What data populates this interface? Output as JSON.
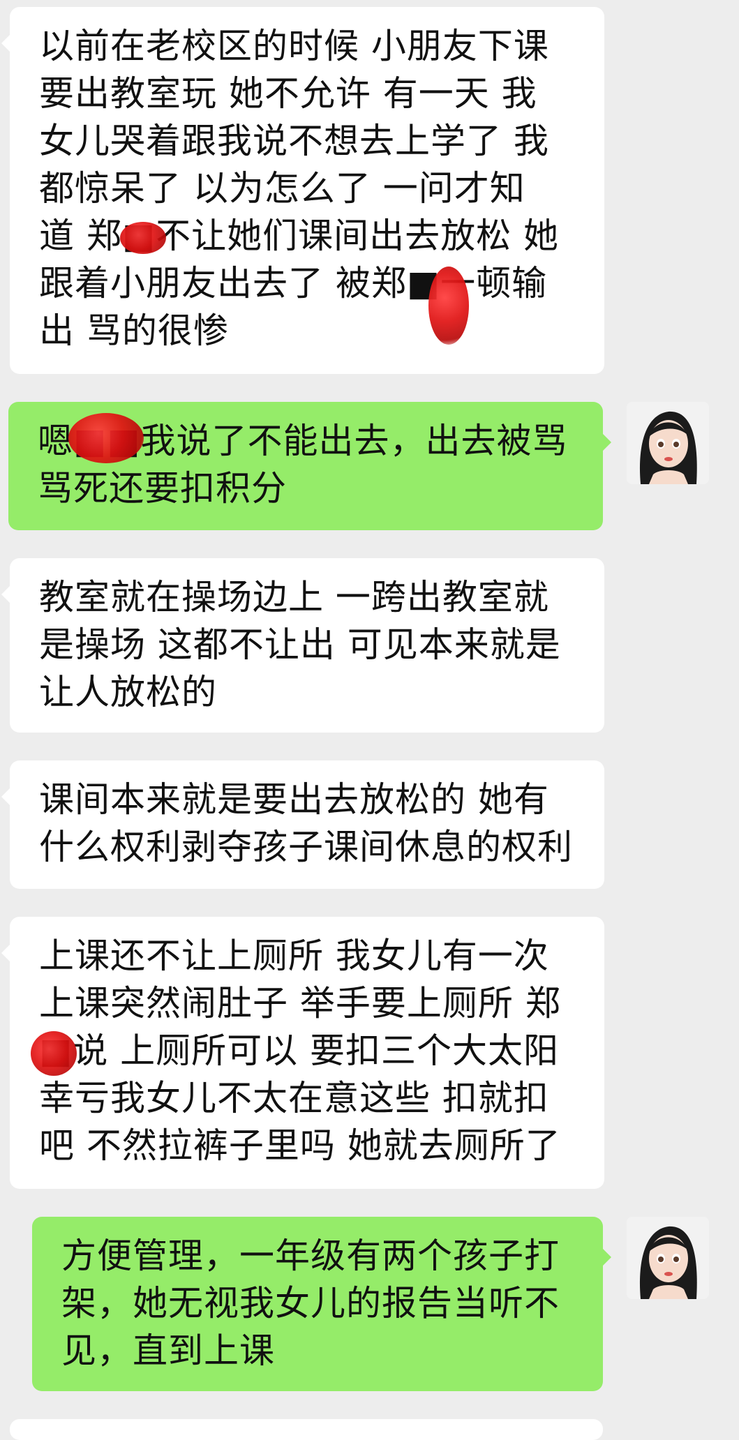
{
  "chat": {
    "messages": [
      {
        "direction": "incoming",
        "text": "以前在老校区的时候 小朋友下课\n要出教室玩 她不允许 有一天 我\n女儿哭着跟我说不想去上学了 我\n都惊呆了 以为怎么了 一问才知\n道 郑■不让她们课间出去放松 她\n跟着小朋友出去了 被郑■一顿输\n出 骂的很惨"
      },
      {
        "direction": "outgoing",
        "text": "嗯■■我说了不能出去，出去被骂\n骂死还要扣积分"
      },
      {
        "direction": "incoming",
        "text": "教室就在操场边上 一跨出教室就\n是操场 这都不让出 可见本来就是\n让人放松的"
      },
      {
        "direction": "incoming",
        "text": "课间本来就是要出去放松的 她有\n什么权利剥夺孩子课间休息的权利"
      },
      {
        "direction": "incoming",
        "text": "上课还不让上厕所 我女儿有一次\n上课突然闹肚子 举手要上厕所 郑\n■说 上厕所可以 要扣三个大太阳\n幸亏我女儿不太在意这些 扣就扣\n吧 不然拉裤子里吗 她就去厕所了"
      },
      {
        "direction": "outgoing",
        "text": "方便管理，一年级有两个孩子打\n架，她无视我女儿的报告当听不\n见，直到上课"
      }
    ]
  },
  "colors": {
    "background": "#ededed",
    "incoming_bubble": "#ffffff",
    "outgoing_bubble": "#95ec69",
    "redaction": "#e01212"
  },
  "icons": {
    "self_avatar": "avatar-woman-illustration"
  }
}
